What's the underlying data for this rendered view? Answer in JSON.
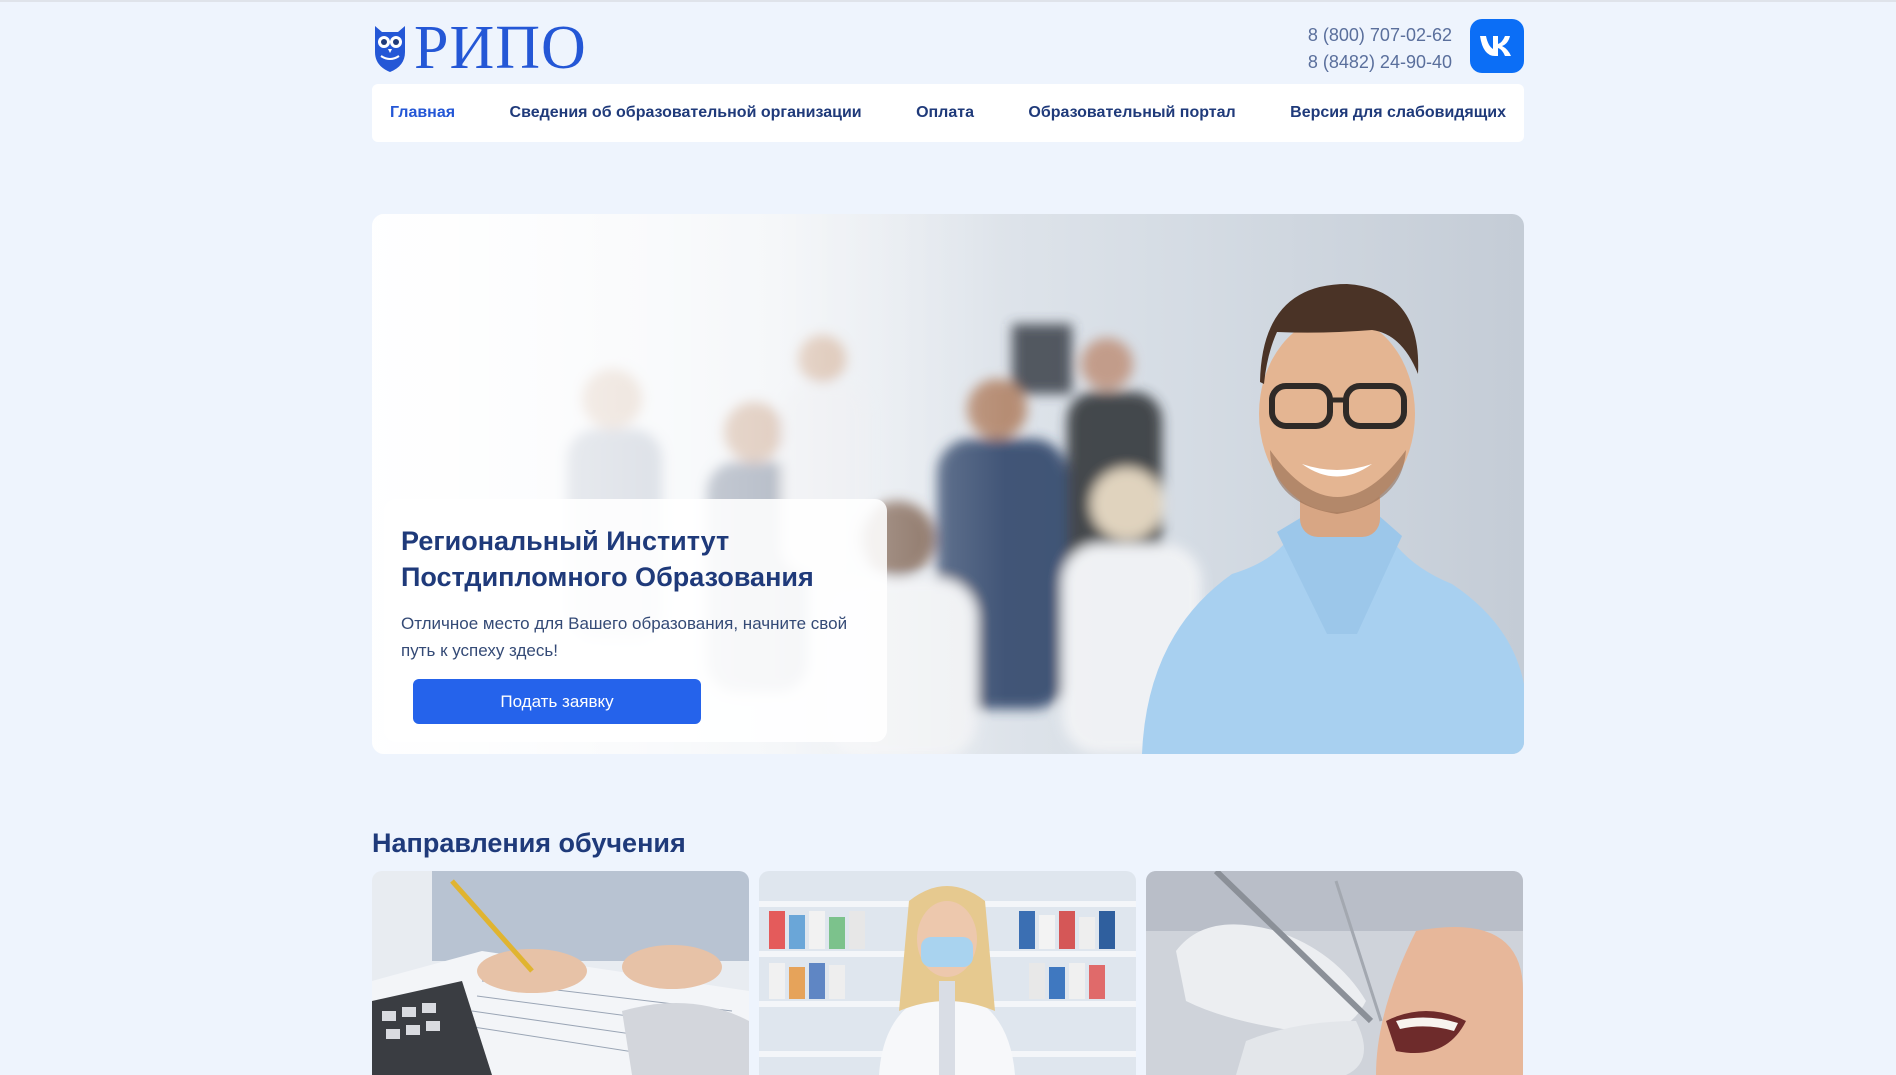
{
  "header": {
    "logo_text": "РИПО",
    "phones": [
      "8 (800) 707-02-62",
      "8 (8482) 24-90-40"
    ],
    "social_icon": "vk-icon"
  },
  "nav": {
    "items": [
      {
        "label": "Главная",
        "active": true
      },
      {
        "label": "Сведения об образовательной организации",
        "active": false
      },
      {
        "label": "Оплата",
        "active": false
      },
      {
        "label": "Образовательный портал",
        "active": false
      },
      {
        "label": "Версия для слабовидящих",
        "active": false
      }
    ]
  },
  "hero": {
    "title_line1": "Региональный Институт",
    "title_line2": "Постдипломного Образования",
    "subtitle_line1": "Отличное место для Вашего образования, начните свой",
    "subtitle_line2": "путь к успеху здесь!",
    "button_label": "Подать заявку"
  },
  "directions": {
    "title": "Направления обучения",
    "cards": [
      {
        "image": "accountant-photo"
      },
      {
        "image": "pharmacist-photo"
      },
      {
        "image": "dentist-photo"
      }
    ]
  },
  "colors": {
    "page_bg": "#eef4fd",
    "accent": "#2457d6",
    "button": "#2563eb",
    "heading": "#1f3a7a",
    "vk": "#0b6ef6"
  }
}
